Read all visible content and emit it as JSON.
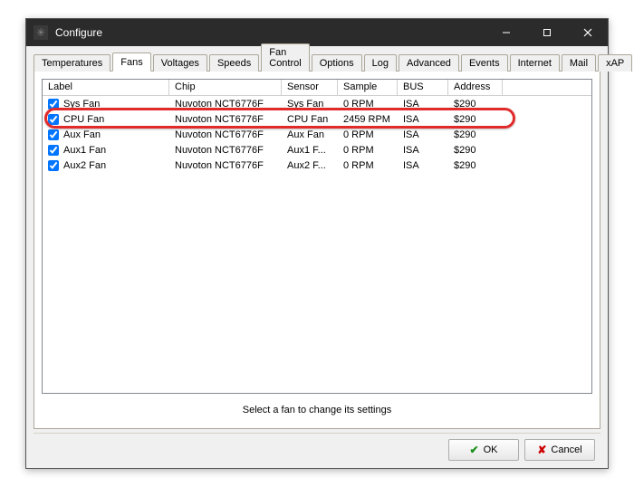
{
  "window": {
    "title": "Configure"
  },
  "tabs": {
    "items": [
      "Temperatures",
      "Fans",
      "Voltages",
      "Speeds",
      "Fan Control",
      "Options",
      "Log",
      "Advanced",
      "Events",
      "Internet",
      "Mail",
      "xAP"
    ],
    "active_index": 1
  },
  "columns": {
    "label": "Label",
    "chip": "Chip",
    "sensor": "Sensor",
    "sample": "Sample",
    "bus": "BUS",
    "address": "Address"
  },
  "rows": [
    {
      "checked": true,
      "label": "Sys Fan",
      "chip": "Nuvoton NCT6776F",
      "sensor": "Sys Fan",
      "sample": "0 RPM",
      "bus": "ISA",
      "address": "$290"
    },
    {
      "checked": true,
      "label": "CPU Fan",
      "chip": "Nuvoton NCT6776F",
      "sensor": "CPU Fan",
      "sample": "2459 RPM",
      "bus": "ISA",
      "address": "$290"
    },
    {
      "checked": true,
      "label": "Aux Fan",
      "chip": "Nuvoton NCT6776F",
      "sensor": "Aux Fan",
      "sample": "0 RPM",
      "bus": "ISA",
      "address": "$290"
    },
    {
      "checked": true,
      "label": "Aux1 Fan",
      "chip": "Nuvoton NCT6776F",
      "sensor": "Aux1 F...",
      "sample": "0 RPM",
      "bus": "ISA",
      "address": "$290"
    },
    {
      "checked": true,
      "label": "Aux2 Fan",
      "chip": "Nuvoton NCT6776F",
      "sensor": "Aux2 F...",
      "sample": "0 RPM",
      "bus": "ISA",
      "address": "$290"
    }
  ],
  "hint": "Select a fan to change its settings",
  "buttons": {
    "ok": "OK",
    "cancel": "Cancel"
  },
  "highlight_row_index": 1
}
